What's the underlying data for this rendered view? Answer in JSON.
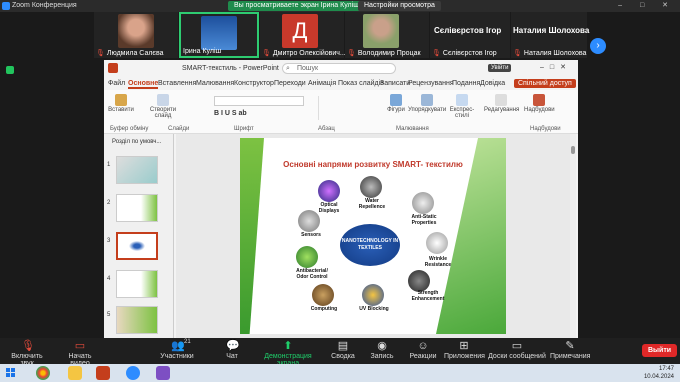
{
  "zoom": {
    "title": "Zoom Конференция",
    "viewing_banner": "Вы просматриваете экран Ірина Куліш",
    "view_settings": "Настройки просмотра",
    "window_controls": "– □ ✕"
  },
  "gallery": {
    "participants": [
      {
        "name": "Людмила Салєва",
        "muted": true
      },
      {
        "name": "Ірина Куліш",
        "muted": false
      },
      {
        "name": "Дмитро Олексійович...",
        "muted": true,
        "initial": "Д"
      },
      {
        "name": "Володимир Процак",
        "muted": true
      },
      {
        "name": "Сєлівєрстов Ігор",
        "muted": true,
        "display": "Сєлівєрстов Ігор"
      },
      {
        "name": "Наталия Шолохова",
        "muted": true,
        "display": "Наталия Шолохова"
      }
    ],
    "next_icon": "chevron-right-icon"
  },
  "powerpoint": {
    "filename": "SMART-текстиль - PowerPoint",
    "search_placeholder": "Пошук",
    "user_badge": "Увійти",
    "tabs": [
      "Файл",
      "Основне",
      "Вставлення",
      "Малювання",
      "Конструктор",
      "Переходи",
      "Анімація",
      "Показ слайдів",
      "Записати",
      "Рецензування",
      "Подання",
      "Довідка"
    ],
    "share_button": "Спільний доступ",
    "ribbon": {
      "paste": "Вставити",
      "new_slide": "Створити слайд",
      "clipboard": "Буфер обміну",
      "slides": "Слайди",
      "font": "Шрифт",
      "paragraph": "Абзац",
      "shapes": "Фігури",
      "arrange": "Упорядкувати",
      "quick_styles": "Експрес-стилі",
      "drawing": "Малювання",
      "editing": "Редагування",
      "addins": "Надбудови",
      "addins_group": "Надбудови"
    },
    "section_label": "Розділ по умовч...",
    "thumbnails": [
      "1",
      "2",
      "3",
      "4",
      "5"
    ],
    "selected_slide": "3",
    "slide": {
      "title": "Основні напрями розвитку SMART- текстилю",
      "hub": "NANOTECHNOLOGY IN TEXTILES",
      "nodes": [
        "Water Repellence",
        "Anti-Static Properties",
        "Wrinkle Resistance",
        "Strength Enhancement",
        "UV Blocking",
        "Computing",
        "Antibacterial/ Odor Control",
        "Sensors",
        "Optical Displays"
      ]
    }
  },
  "toolbar": {
    "unmute": "Включить звук",
    "start_video": "Начать видео",
    "participants": "Участники",
    "participants_count": "21",
    "chat": "Чат",
    "share_screen": "Демонстрация экрана",
    "summary": "Сводка",
    "record": "Запись",
    "reactions": "Реакции",
    "apps": "Приложения",
    "whiteboards": "Доски сообщений",
    "notes": "Примечания",
    "leave": "Выйти"
  },
  "taskbar": {
    "time": "17:47",
    "date": "10.04.2024"
  }
}
